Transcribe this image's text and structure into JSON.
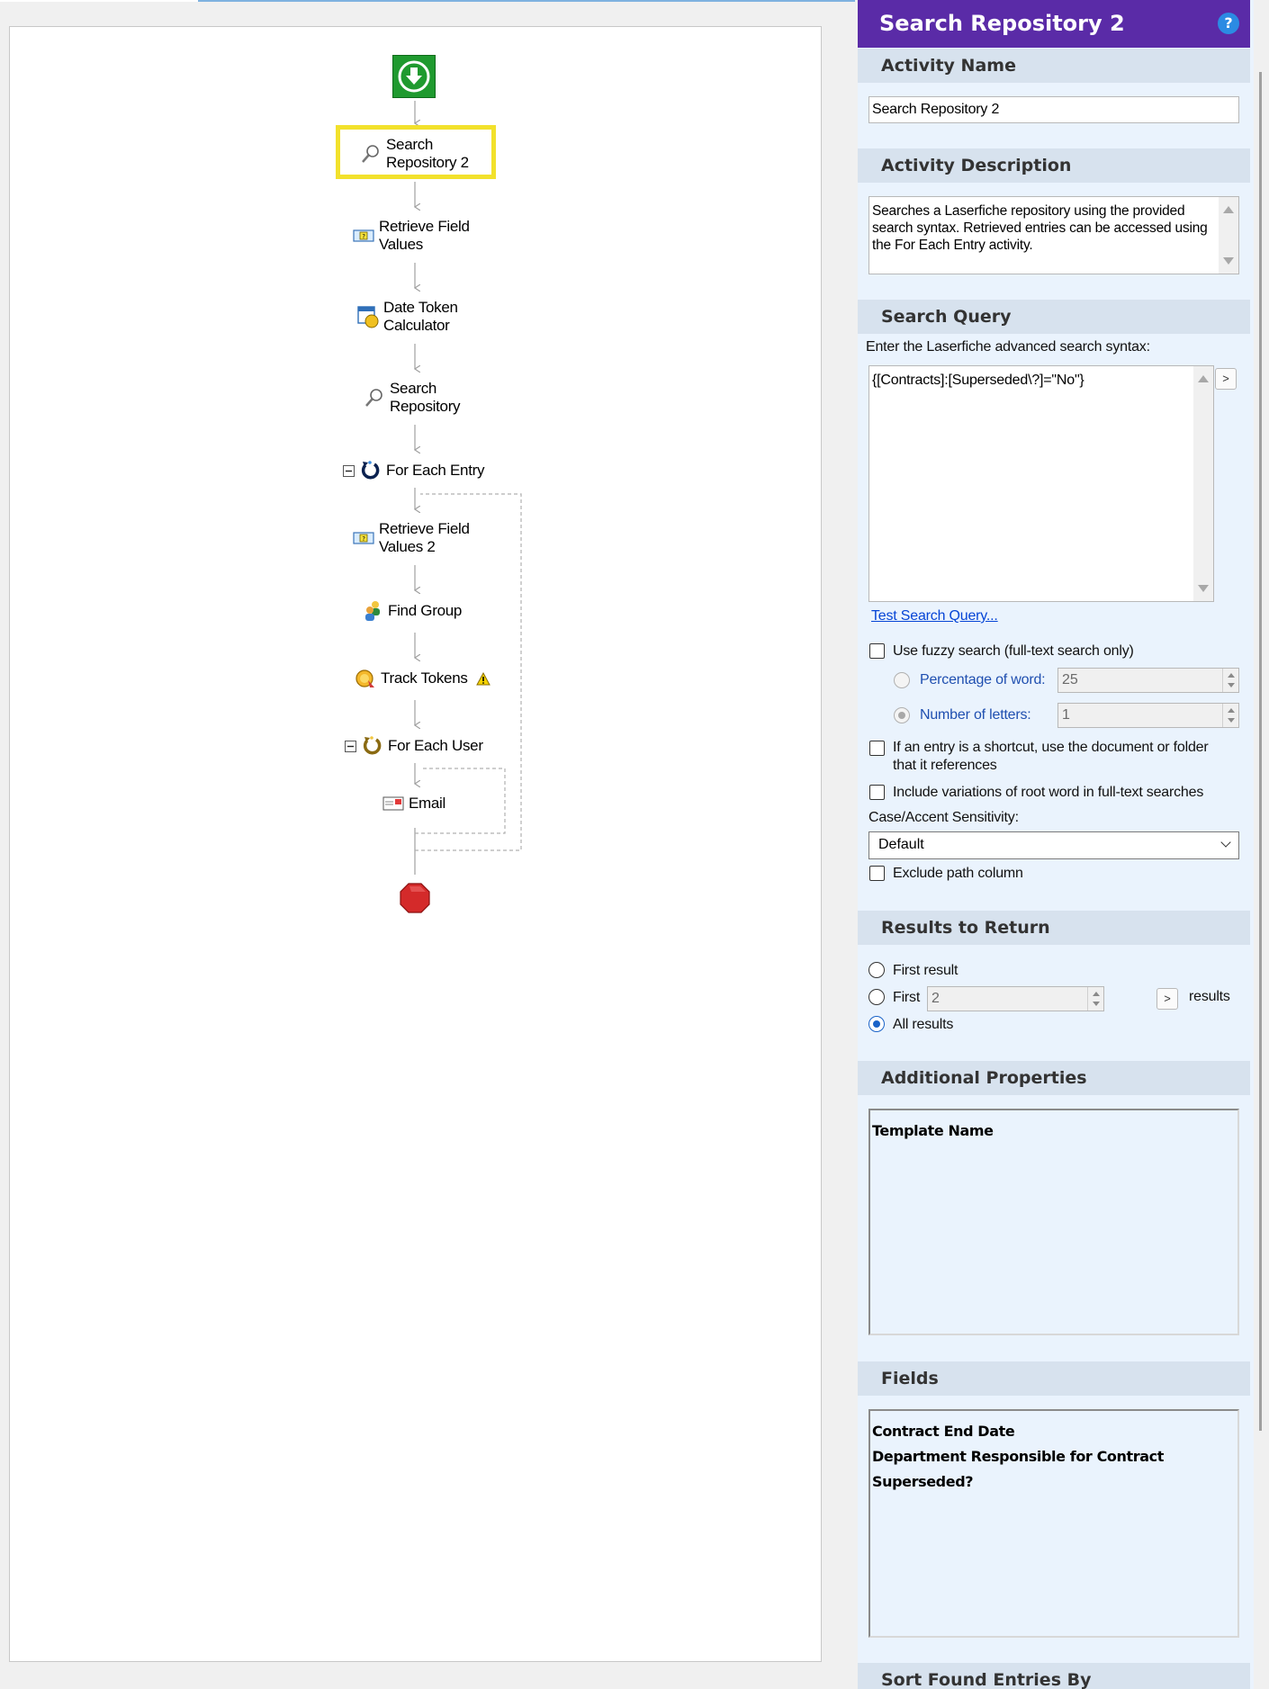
{
  "workflow": {
    "nodes": [
      {
        "id": "search-repository-2",
        "label": "Search\nRepository 2",
        "icon": "magnifier-icon",
        "selected": true
      },
      {
        "id": "retrieve-field-values",
        "label": "Retrieve Field\nValues",
        "icon": "field-values-icon"
      },
      {
        "id": "date-token-calculator",
        "label": "Date Token\nCalculator",
        "icon": "calendar-clock-icon"
      },
      {
        "id": "search-repository",
        "label": "Search\nRepository",
        "icon": "magnifier-icon"
      },
      {
        "id": "for-each-entry",
        "label": "For Each Entry",
        "icon": "loop-icon"
      },
      {
        "id": "retrieve-field-values-2",
        "label": "Retrieve Field\nValues 2",
        "icon": "field-values-icon"
      },
      {
        "id": "find-group",
        "label": "Find Group",
        "icon": "group-icon"
      },
      {
        "id": "track-tokens",
        "label": "Track Tokens",
        "icon": "token-icon"
      },
      {
        "id": "for-each-user",
        "label": "For Each User",
        "icon": "loop-icon"
      },
      {
        "id": "email",
        "label": "Email",
        "icon": "email-icon"
      }
    ],
    "start_icon": "download-arrow-icon",
    "end_icon": "stop-octagon-icon",
    "warning_icon": "warning-icon",
    "collapse_icon": "collapse-minus-icon",
    "colors": {
      "start": "#1f9a2f",
      "end": "#d42a2a",
      "selection": "#f2e12c"
    }
  },
  "panel": {
    "title": "Search Repository 2",
    "help_icon": "?",
    "colors": {
      "title_bg": "#5a2ba7",
      "section_bg": "#d7e2ee",
      "panel_bg": "#eaf3fd"
    },
    "activity_name": {
      "header": "Activity Name",
      "value": "Search Repository 2"
    },
    "activity_description": {
      "header": "Activity Description",
      "text": "Searches a Laserfiche repository using the provided search syntax.  Retrieved entries can be accessed using the For Each Entry activity."
    },
    "search_query": {
      "header": "Search Query",
      "instruction": "Enter the Laserfiche advanced search syntax:",
      "value": "{[Contracts]:[Superseded\\?]=\"No\"}",
      "expand_button": ">",
      "test_link": "Test Search Query...",
      "fuzzy_label": "Use fuzzy search (full-text search only)",
      "fuzzy_checked": false,
      "percentage_label": "Percentage of word:",
      "percentage_value": "25",
      "letters_label": "Number of letters:",
      "letters_value": "1",
      "shortcut_label": "If an entry is a shortcut, use the document or folder\nthat it references",
      "shortcut_checked": false,
      "variations_label": "Include variations of root word in full-text searches",
      "variations_checked": false,
      "case_label": "Case/Accent Sensitivity:",
      "case_value": "Default",
      "exclude_label": "Exclude path column",
      "exclude_checked": false
    },
    "results": {
      "header": "Results to Return",
      "first_result_label": "First result",
      "first_label": "First",
      "first_value": "2",
      "first_button": ">",
      "results_suffix": "results",
      "all_results_label": "All results",
      "selected": "All results"
    },
    "additional_properties": {
      "header": "Additional Properties",
      "items": [
        "Template Name"
      ]
    },
    "fields": {
      "header": "Fields",
      "items": [
        "Contract End Date",
        "Department Responsible for Contract",
        "Superseded?"
      ]
    },
    "sort": {
      "header": "Sort Found Entries By"
    }
  }
}
